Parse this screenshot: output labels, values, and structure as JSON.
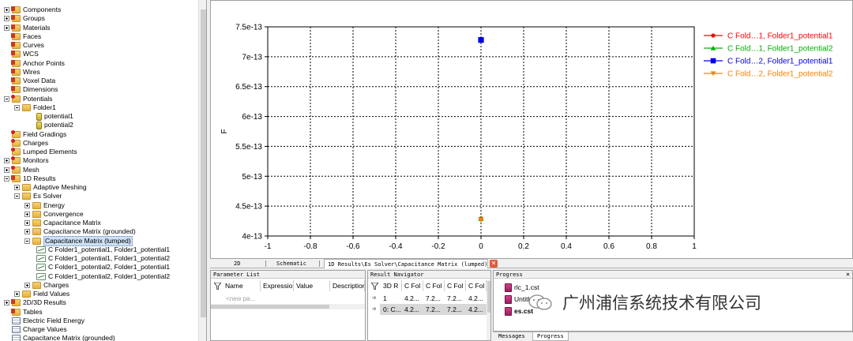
{
  "tree": {
    "items": [
      {
        "label": "Components",
        "level": 0,
        "expander": "plus",
        "icon": "folderr"
      },
      {
        "label": "Groups",
        "level": 0,
        "expander": "plus",
        "icon": "folderr"
      },
      {
        "label": "Materials",
        "level": 0,
        "expander": "plus",
        "icon": "folderr"
      },
      {
        "label": "Faces",
        "level": 0,
        "expander": "none",
        "icon": "folderr"
      },
      {
        "label": "Curves",
        "level": 0,
        "expander": "none",
        "icon": "folderr"
      },
      {
        "label": "WCS",
        "level": 0,
        "expander": "none",
        "icon": "folderr"
      },
      {
        "label": "Anchor Points",
        "level": 0,
        "expander": "none",
        "icon": "folderr"
      },
      {
        "label": "Wires",
        "level": 0,
        "expander": "none",
        "icon": "folderr"
      },
      {
        "label": "Voxel Data",
        "level": 0,
        "expander": "none",
        "icon": "folderr"
      },
      {
        "label": "Dimensions",
        "level": 0,
        "expander": "none",
        "icon": "folderr"
      },
      {
        "label": "Potentials",
        "level": 0,
        "expander": "minus",
        "icon": "folderx"
      },
      {
        "label": "Folder1",
        "level": 1,
        "expander": "minus",
        "icon": "folder"
      },
      {
        "label": "potential1",
        "level": 3,
        "expander": "none",
        "icon": "pot"
      },
      {
        "label": "potential2",
        "level": 3,
        "expander": "none",
        "icon": "pot"
      },
      {
        "label": "Field Gradings",
        "level": 0,
        "expander": "none",
        "icon": "folderx"
      },
      {
        "label": "Charges",
        "level": 0,
        "expander": "none",
        "icon": "folderx"
      },
      {
        "label": "Lumped Elements",
        "level": 0,
        "expander": "none",
        "icon": "folderx"
      },
      {
        "label": "Monitors",
        "level": 0,
        "expander": "plus",
        "icon": "folderx"
      },
      {
        "label": "Mesh",
        "level": 0,
        "expander": "plus",
        "icon": "folderx"
      },
      {
        "label": "1D Results",
        "level": 0,
        "expander": "minus",
        "icon": "folderr"
      },
      {
        "label": "Adaptive Meshing",
        "level": 1,
        "expander": "plus",
        "icon": "folder"
      },
      {
        "label": "Es Solver",
        "level": 1,
        "expander": "minus",
        "icon": "folder"
      },
      {
        "label": "Energy",
        "level": 2,
        "expander": "plus",
        "icon": "folder"
      },
      {
        "label": "Convergence",
        "level": 2,
        "expander": "plus",
        "icon": "folder"
      },
      {
        "label": "Capacitance Matrix",
        "level": 2,
        "expander": "plus",
        "icon": "folder"
      },
      {
        "label": "Capacitance Matrix (grounded)",
        "level": 2,
        "expander": "plus",
        "icon": "folder"
      },
      {
        "label": "Capacitance Matrix (lumped)",
        "level": 2,
        "expander": "minus",
        "icon": "folder",
        "selected": true
      },
      {
        "label": "C Folder1_potential1, Folder1_potential1",
        "level": 3,
        "expander": "none",
        "icon": "curve"
      },
      {
        "label": "C Folder1_potential1, Folder1_potential2",
        "level": 3,
        "expander": "none",
        "icon": "curve"
      },
      {
        "label": "C Folder1_potential2, Folder1_potential1",
        "level": 3,
        "expander": "none",
        "icon": "curve"
      },
      {
        "label": "C Folder1_potential2, Folder1_potential2",
        "level": 3,
        "expander": "none",
        "icon": "curve"
      },
      {
        "label": "Charges",
        "level": 2,
        "expander": "plus",
        "icon": "folder"
      },
      {
        "label": "Field Values",
        "level": 1,
        "expander": "plus",
        "icon": "folder"
      },
      {
        "label": "2D/3D Results",
        "level": 0,
        "expander": "plus",
        "icon": "folderr"
      },
      {
        "label": "Tables",
        "level": 0,
        "expander": "none",
        "icon": "folderr"
      },
      {
        "label": "Electric Field Energy",
        "level": 0,
        "expander": "none",
        "icon": "table"
      },
      {
        "label": "Charge Values",
        "level": 0,
        "expander": "none",
        "icon": "table"
      },
      {
        "label": "Capacitance Matrix (grounded)",
        "level": 0,
        "expander": "none",
        "icon": "table"
      }
    ]
  },
  "chart_data": {
    "type": "scatter",
    "xlim": [
      -1,
      1
    ],
    "ylim": [
      4e-13,
      7.5e-13
    ],
    "x_ticks": [
      -1,
      -0.8,
      -0.6,
      -0.4,
      -0.2,
      0,
      0.2,
      0.4,
      0.6,
      0.8,
      1
    ],
    "x_tick_labels": [
      "-1",
      "-0.8",
      "-0.6",
      "-0.4",
      "-0.2",
      "0",
      "0.2",
      "0.4",
      "0.6",
      "0.8",
      "1"
    ],
    "y_ticks": [
      4e-13,
      4.5e-13,
      5e-13,
      5.5e-13,
      6e-13,
      6.5e-13,
      7e-13,
      7.5e-13
    ],
    "y_tick_labels": [
      "4e-13",
      "4.5e-13",
      "5e-13",
      "5.5e-13",
      "6e-13",
      "6.5e-13",
      "7e-13",
      "7.5e-13"
    ],
    "ylabel": "F",
    "xlabel": "",
    "grid": true,
    "legend_position": "right",
    "series": [
      {
        "name": "C Fold…1, Folder1_potential1",
        "color": "#ff0000",
        "marker": "circle",
        "x": [
          0
        ],
        "y": [
          4.29e-13
        ]
      },
      {
        "name": "C Fold…1, Folder1_potential2",
        "color": "#00b000",
        "marker": "triangle-up",
        "x": [
          0
        ],
        "y": [
          4.29e-13
        ]
      },
      {
        "name": "C Fold…2, Folder1_potential1",
        "color": "#0000e0",
        "marker": "square",
        "x": [
          0
        ],
        "y": [
          7.28e-13
        ]
      },
      {
        "name": "C Fold…2, Folder1_potential2",
        "color": "#ff8000",
        "marker": "triangle-down",
        "x": [
          0
        ],
        "y": [
          4.27e-13
        ]
      }
    ]
  },
  "tabs": {
    "items": [
      {
        "label": "2D"
      },
      {
        "label": "Schematic"
      },
      {
        "label": "1D Results\\Es Solver\\Capacitance Matrix (lumped)",
        "active": true
      }
    ],
    "close_glyph": "✕"
  },
  "parameter_list": {
    "title": "Parameter List",
    "columns": [
      "Name",
      "Expression",
      "Value",
      "Description"
    ],
    "placeholder": "<new pa..."
  },
  "result_navigator": {
    "title": "Result Navigator",
    "columns": [
      "3D R",
      "C Fol",
      "C Fol",
      "C Fol",
      "C Fol"
    ],
    "rows": [
      {
        "cells": [
          "1",
          "4.2...",
          "7.2...",
          "7.2...",
          "4.2..."
        ],
        "selected": false
      },
      {
        "cells": [
          "0: C...",
          "4.2...",
          "7.2...",
          "7.2...",
          "4.2..."
        ],
        "selected": true
      }
    ]
  },
  "progress": {
    "title": "Progress",
    "items": [
      "rlc_1.cst",
      "Untitl",
      "es.cst"
    ],
    "tabs": [
      {
        "label": "Messages"
      },
      {
        "label": "Progress",
        "active": true
      }
    ]
  },
  "watermark": {
    "text": "广州浦信系统技术有限公司"
  },
  "close_x": "×"
}
